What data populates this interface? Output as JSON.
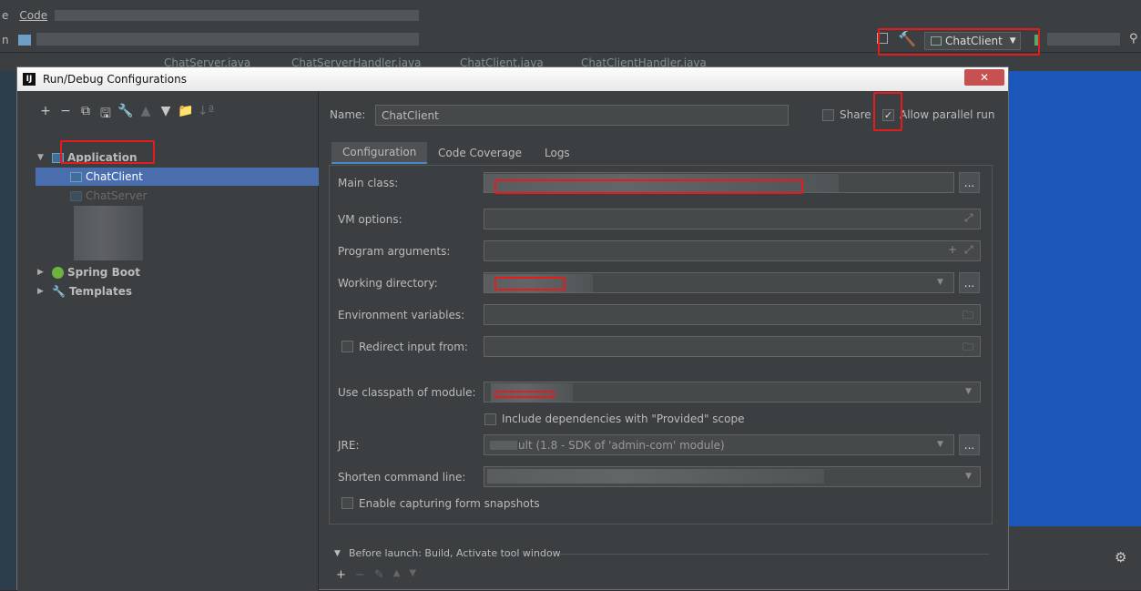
{
  "ide": {
    "menu": [
      "e",
      "Code"
    ],
    "nav_first": "n",
    "run_config_label": "ChatClient",
    "file_tabs": [
      "ChatServer.java",
      "ChatServerHandler.java",
      "ChatClient.java",
      "ChatClientHandler.java"
    ]
  },
  "dialog": {
    "title": "Run/Debug Configurations",
    "app_icon_text": "IJ",
    "close_symbol": "✕",
    "toolbar": [
      "+",
      "−",
      "⧉",
      "🖫",
      "🔧",
      "▲",
      "▼",
      "📁",
      "↓ª"
    ],
    "tree": {
      "group_application": "Application",
      "item_selected": "ChatClient",
      "item_second": "ChatServer",
      "group_spring": "Spring Boot",
      "group_templates": "Templates"
    },
    "name_label": "Name:",
    "name_value": "ChatClient",
    "share_label": "Share",
    "allow_parallel_label": "Allow parallel run",
    "allow_parallel_checked": true,
    "tabs": [
      "Configuration",
      "Code Coverage",
      "Logs"
    ],
    "fields": {
      "main_class": "Main class:",
      "vm_options": "VM options:",
      "program_arguments": "Program arguments:",
      "working_directory": "Working directory:",
      "environment_variables": "Environment variables:",
      "redirect_input": "Redirect input from:",
      "use_classpath": "Use classpath of module:",
      "include_deps": "Include dependencies with \"Provided\" scope",
      "jre": "JRE:",
      "jre_value": "ult (1.8 - SDK of 'admin-com' module)",
      "shorten_cmd": "Shorten command line:",
      "enable_snapshots": "Enable capturing form snapshots"
    },
    "before_launch": "Before launch: Build, Activate tool window",
    "ellipsis": "...",
    "before_toolbar": [
      "+",
      "−",
      "✎",
      "▲",
      "▼"
    ]
  },
  "colors": {
    "highlight_red": "#e51c1c",
    "selection_blue": "#4b6eaf",
    "editor_blue": "#1b57b8"
  }
}
